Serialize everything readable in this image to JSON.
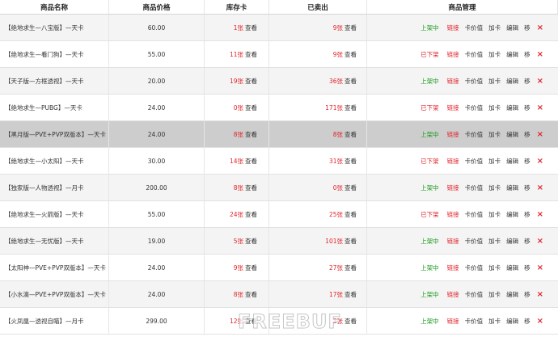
{
  "headers": {
    "name": "商品名称",
    "price": "商品价格",
    "stock": "库存卡",
    "sold": "已卖出",
    "manage": "商品管理"
  },
  "labels": {
    "view": "查看",
    "link": "链接",
    "card_price": "卡价值",
    "add_card": "加卡",
    "edit": "编辑",
    "move": "移",
    "delete_icon": "×"
  },
  "rows": [
    {
      "name": "【绝地求生—八宝版】—天卡",
      "price": "60.00",
      "stock": "1张",
      "sold": "9张",
      "status": "上架中",
      "on": true
    },
    {
      "name": "【绝地求生—看门狗】—天卡",
      "price": "55.00",
      "stock": "11张",
      "sold": "9张",
      "status": "已下架",
      "on": false
    },
    {
      "name": "【天子版—方框透视】—天卡",
      "price": "20.00",
      "stock": "19张",
      "sold": "36张",
      "status": "上架中",
      "on": true
    },
    {
      "name": "【绝地求生—PUBG】—天卡",
      "price": "24.00",
      "stock": "0张",
      "sold": "171张",
      "status": "已下架",
      "on": false
    },
    {
      "name": "【黑月版—PVE+PVP双版本】—天卡",
      "price": "24.00",
      "stock": "8张",
      "sold": "8张",
      "status": "上架中",
      "on": true
    },
    {
      "name": "【绝地求生—小太阳】—天卡",
      "price": "30.00",
      "stock": "14张",
      "sold": "31张",
      "status": "已下架",
      "on": false
    },
    {
      "name": "【独家版—人物透视】—月卡",
      "price": "200.00",
      "stock": "8张",
      "sold": "0张",
      "status": "上架中",
      "on": true
    },
    {
      "name": "【绝地求生—火箭版】—天卡",
      "price": "55.00",
      "stock": "24张",
      "sold": "25张",
      "status": "已下架",
      "on": false
    },
    {
      "name": "【绝地求生—无忧版】—天卡",
      "price": "19.00",
      "stock": "5张",
      "sold": "101张",
      "status": "上架中",
      "on": true
    },
    {
      "name": "【太阳神—PVE+PVP双版本】—天卡",
      "price": "24.00",
      "stock": "9张",
      "sold": "27张",
      "status": "上架中",
      "on": true
    },
    {
      "name": "【小水滴—PVE+PVP双版本】—天卡",
      "price": "24.00",
      "stock": "8张",
      "sold": "17张",
      "status": "上架中",
      "on": true
    },
    {
      "name": "【火凤凰—透视自瞄】—月卡",
      "price": "299.00",
      "stock": "12张",
      "sold": "3张",
      "status": "上架中",
      "on": true
    }
  ],
  "watermark": "FREEBUF",
  "colors": {
    "on": "#1a9a1a",
    "off": "#e0242b",
    "count": "#e0242b"
  }
}
